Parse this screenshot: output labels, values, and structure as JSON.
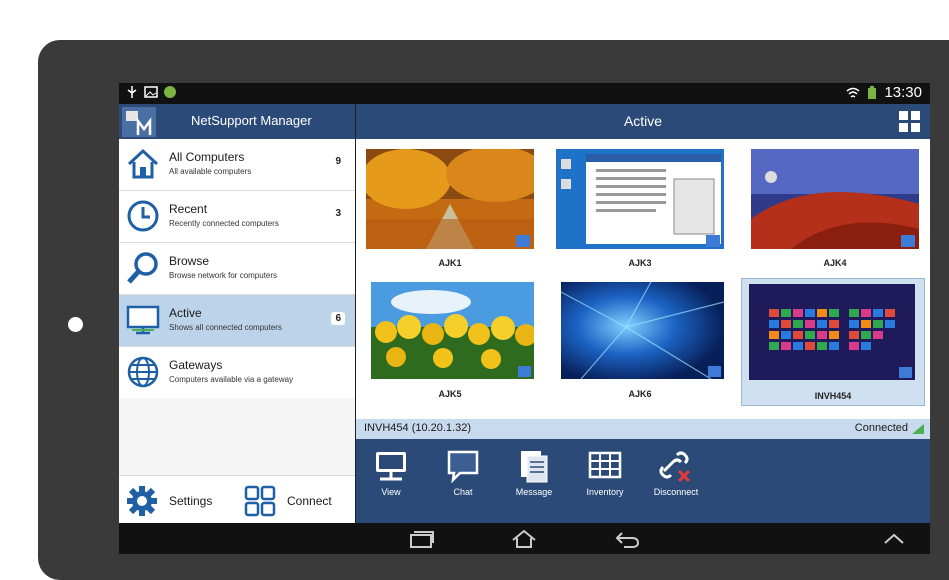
{
  "statusbar": {
    "time": "13:30"
  },
  "app": {
    "title": "NetSupport Manager"
  },
  "nav": {
    "items": [
      {
        "title": "All Computers",
        "subtitle": "All available computers",
        "count": "9"
      },
      {
        "title": "Recent",
        "subtitle": "Recently connected computers",
        "count": "3"
      },
      {
        "title": "Browse",
        "subtitle": "Browse network for computers",
        "count": ""
      },
      {
        "title": "Active",
        "subtitle": "Shows all connected computers",
        "count": "6"
      },
      {
        "title": "Gateways",
        "subtitle": "Computers available via a gateway",
        "count": ""
      }
    ],
    "settings_label": "Settings",
    "connect_label": "Connect"
  },
  "main": {
    "title": "Active",
    "computers": [
      "AJK1",
      "AJK3",
      "AJK4",
      "AJK5",
      "AJK6",
      "INVH454"
    ],
    "selected": "INVH454",
    "status_host": "INVH454 (10.20.1.32)",
    "status_conn": "Connected"
  },
  "toolbar": {
    "view": "View",
    "chat": "Chat",
    "message": "Message",
    "inventory": "Inventory",
    "disconnect": "Disconnect"
  },
  "colors": {
    "accent": "#2b4a78",
    "selected": "#bcd3ea",
    "icon_blue": "#1f5fa6"
  }
}
